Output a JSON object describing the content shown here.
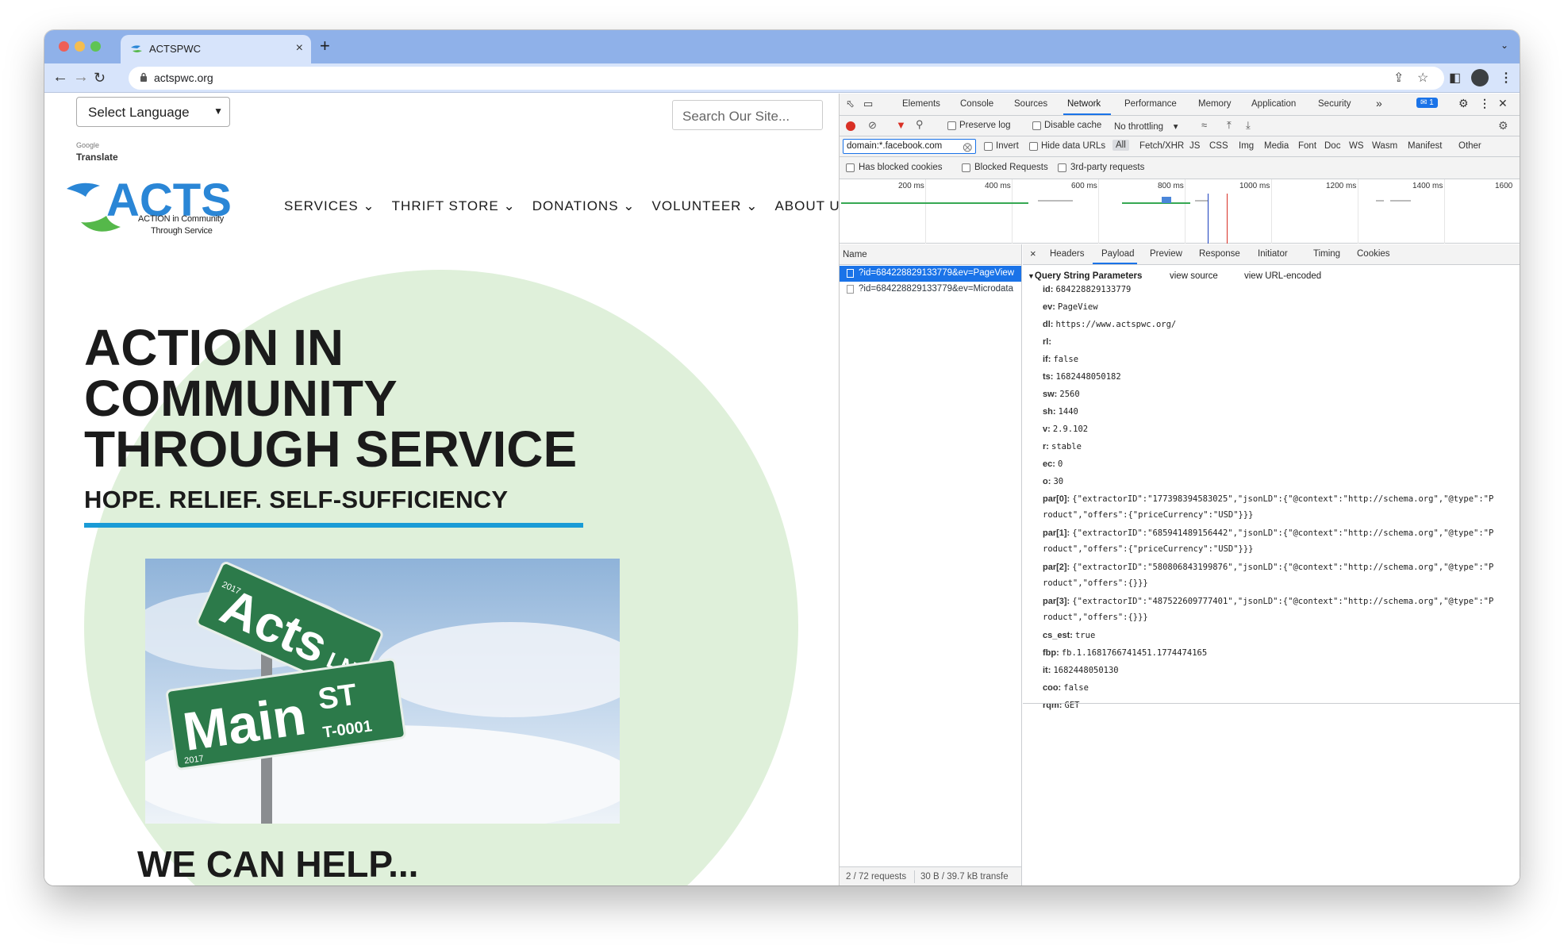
{
  "browser": {
    "tab_title": "ACTSPWC",
    "tab_close": "×",
    "new_tab": "+",
    "url": "actspwc.org",
    "avatar_color": "#3c4043"
  },
  "site": {
    "language_select": "Select Language",
    "powered_by": "Google",
    "translate": "Translate",
    "search_placeholder": "Search Our Site...",
    "logo": {
      "wordmark": "ACTS",
      "line1": "ACTION in Community",
      "line2": "Through Service"
    },
    "nav": [
      "SERVICES",
      "THRIFT STORE",
      "DONATIONS",
      "VOLUNTEER",
      "ABOUT US"
    ],
    "hero": {
      "title": "ACTION IN COMMUNITY THROUGH SERVICE",
      "subtitle": "HOPE. RELIEF. SELF-SUFFICIENCY",
      "sign_top": "Acts",
      "sign_top_suffix": "LN",
      "sign_top_year": "2017",
      "sign_bottom": "Main",
      "sign_bottom_suffix": "ST",
      "sign_bottom_code": "T-0001",
      "sign_bottom_year": "2017",
      "heading": "WE CAN HELP..."
    },
    "colors": {
      "accent": "#1a9bd6",
      "circle": "#dff0da",
      "logo_blue": "#2a86d6",
      "logo_green": "#55b84a"
    }
  },
  "devtools": {
    "tabs": [
      "Elements",
      "Console",
      "Sources",
      "Network",
      "Performance",
      "Memory",
      "Application",
      "Security"
    ],
    "active_tab": "Network",
    "more_tabs": "»",
    "issues_badge": "1",
    "toolbar": {
      "preserve_log": "Preserve log",
      "disable_cache": "Disable cache",
      "throttling": "No throttling"
    },
    "filter": {
      "value": "domain:*.facebook.com",
      "invert": "Invert",
      "hide_data_urls": "Hide data URLs",
      "types": [
        "All",
        "Fetch/XHR",
        "JS",
        "CSS",
        "Img",
        "Media",
        "Font",
        "Doc",
        "WS",
        "Wasm",
        "Manifest",
        "Other"
      ],
      "blocked_cookies": "Has blocked cookies",
      "blocked_requests": "Blocked Requests",
      "third_party": "3rd-party requests"
    },
    "timeline_ticks": [
      "200 ms",
      "400 ms",
      "600 ms",
      "800 ms",
      "1000 ms",
      "1200 ms",
      "1400 ms",
      "1600"
    ],
    "requests_header": "Name",
    "requests": [
      "?id=684228829133779&ev=PageView",
      "?id=684228829133779&ev=Microdata"
    ],
    "status": {
      "count": "2 / 72 requests",
      "transfer": "30 B / 39.7 kB transfe"
    },
    "detail_close": "×",
    "detail_tabs": [
      "Headers",
      "Payload",
      "Preview",
      "Response",
      "Initiator",
      "Timing",
      "Cookies"
    ],
    "qs_header": "Query String Parameters",
    "view_source": "view source",
    "view_url_encoded": "view URL-encoded",
    "params": [
      {
        "k": "id:",
        "v": "684228829133779",
        "c": ""
      },
      {
        "k": "ev:",
        "v": "PageView",
        "c": ""
      },
      {
        "k": "dl:",
        "v": "https://www.actspwc.org/",
        "c": ""
      },
      {
        "k": "rl:",
        "v": "",
        "c": ""
      },
      {
        "k": "if:",
        "v": "false",
        "c": ""
      },
      {
        "k": "ts:",
        "v": "1682448050182",
        "c": ""
      },
      {
        "k": "sw:",
        "v": "2560",
        "c": ""
      },
      {
        "k": "sh:",
        "v": "1440",
        "c": ""
      },
      {
        "k": "v:",
        "v": "2.9.102",
        "c": ""
      },
      {
        "k": "r:",
        "v": "stable",
        "c": ""
      },
      {
        "k": "ec:",
        "v": "0",
        "c": ""
      },
      {
        "k": "o:",
        "v": "30",
        "c": ""
      },
      {
        "k": "par[0]:",
        "v": "{\"extractorID\":\"177398394583025\",\"jsonLD\":{\"@context\":\"http://schema.org\",\"@type\":\"P",
        "c": "roduct\",\"offers\":{\"priceCurrency\":\"USD\"}}}"
      },
      {
        "k": "par[1]:",
        "v": "{\"extractorID\":\"685941489156442\",\"jsonLD\":{\"@context\":\"http://schema.org\",\"@type\":\"P",
        "c": "roduct\",\"offers\":{\"priceCurrency\":\"USD\"}}}"
      },
      {
        "k": "par[2]:",
        "v": "{\"extractorID\":\"580806843199876\",\"jsonLD\":{\"@context\":\"http://schema.org\",\"@type\":\"P",
        "c": "roduct\",\"offers\":{}}}"
      },
      {
        "k": "par[3]:",
        "v": "{\"extractorID\":\"487522609777401\",\"jsonLD\":{\"@context\":\"http://schema.org\",\"@type\":\"P",
        "c": "roduct\",\"offers\":{}}}"
      },
      {
        "k": "cs_est:",
        "v": "true",
        "c": ""
      },
      {
        "k": "fbp:",
        "v": "fb.1.1681766741451.1774474165",
        "c": ""
      },
      {
        "k": "it:",
        "v": "1682448050130",
        "c": ""
      },
      {
        "k": "coo:",
        "v": "false",
        "c": ""
      },
      {
        "k": "rqm:",
        "v": "GET",
        "c": ""
      }
    ]
  }
}
